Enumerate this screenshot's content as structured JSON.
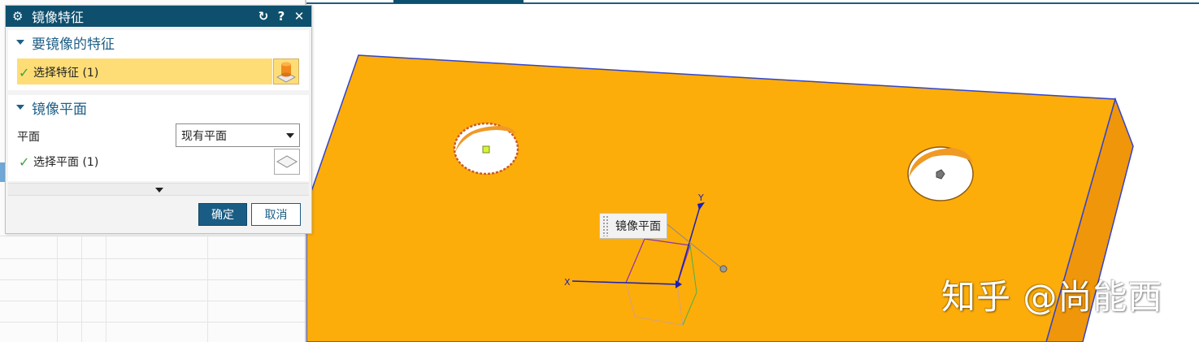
{
  "dialog": {
    "title": "镜像特征",
    "icons": {
      "settings": "gear-icon",
      "reset": "reset-icon",
      "help": "help-icon",
      "close": "close-icon"
    },
    "help_glyph": "?",
    "close_glyph": "✕",
    "reset_glyph": "↻",
    "settings_glyph": "⚙",
    "sections": {
      "features": {
        "label": "要镜像的特征",
        "select_text": "选择特征 (1)"
      },
      "mirror_plane": {
        "label": "镜像平面",
        "plane_label": "平面",
        "plane_value": "现有平面",
        "select_text": "选择平面 (1)"
      }
    },
    "ok_label": "确定",
    "cancel_label": "取消",
    "check_glyph": "✓"
  },
  "viewport": {
    "tooltip": "镜像平面",
    "axis_x": "X",
    "axis_y": "Y",
    "watermark": "知乎 @尚能西",
    "colors": {
      "part": "#fdad09",
      "side": "#f0960a",
      "edge": "#3344cc"
    }
  }
}
